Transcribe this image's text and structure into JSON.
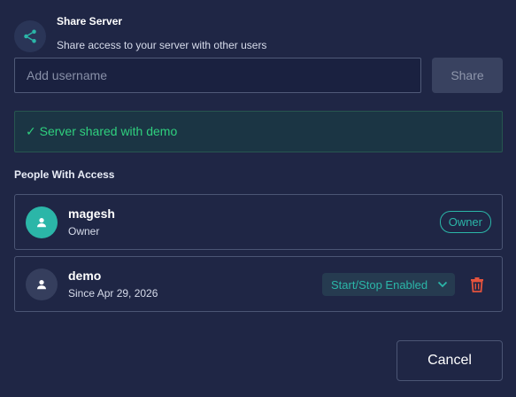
{
  "dialog": {
    "title": "Share Server",
    "subtitle": "Share access to your server with other users",
    "icon": "share-icon"
  },
  "share_form": {
    "input_value": "",
    "input_placeholder": "Add username",
    "share_label": "Share"
  },
  "banner": {
    "message": "✓ Server shared with demo",
    "color": "#2fd07e"
  },
  "access_section": {
    "title": "People With Access",
    "people": [
      {
        "name": "magesh",
        "meta": "Owner",
        "badge": "Owner",
        "icon": "user-icon"
      },
      {
        "name": "demo",
        "meta": "Since Apr 29, 2026",
        "permission": "Start/Stop Enabled",
        "icon": "user-icon",
        "action_icon": "trash-icon"
      }
    ]
  },
  "footer": {
    "cancel_label": "Cancel"
  },
  "colors": {
    "background": "#1f2645",
    "accent": "#2bb6a8",
    "danger": "#e4533d"
  }
}
